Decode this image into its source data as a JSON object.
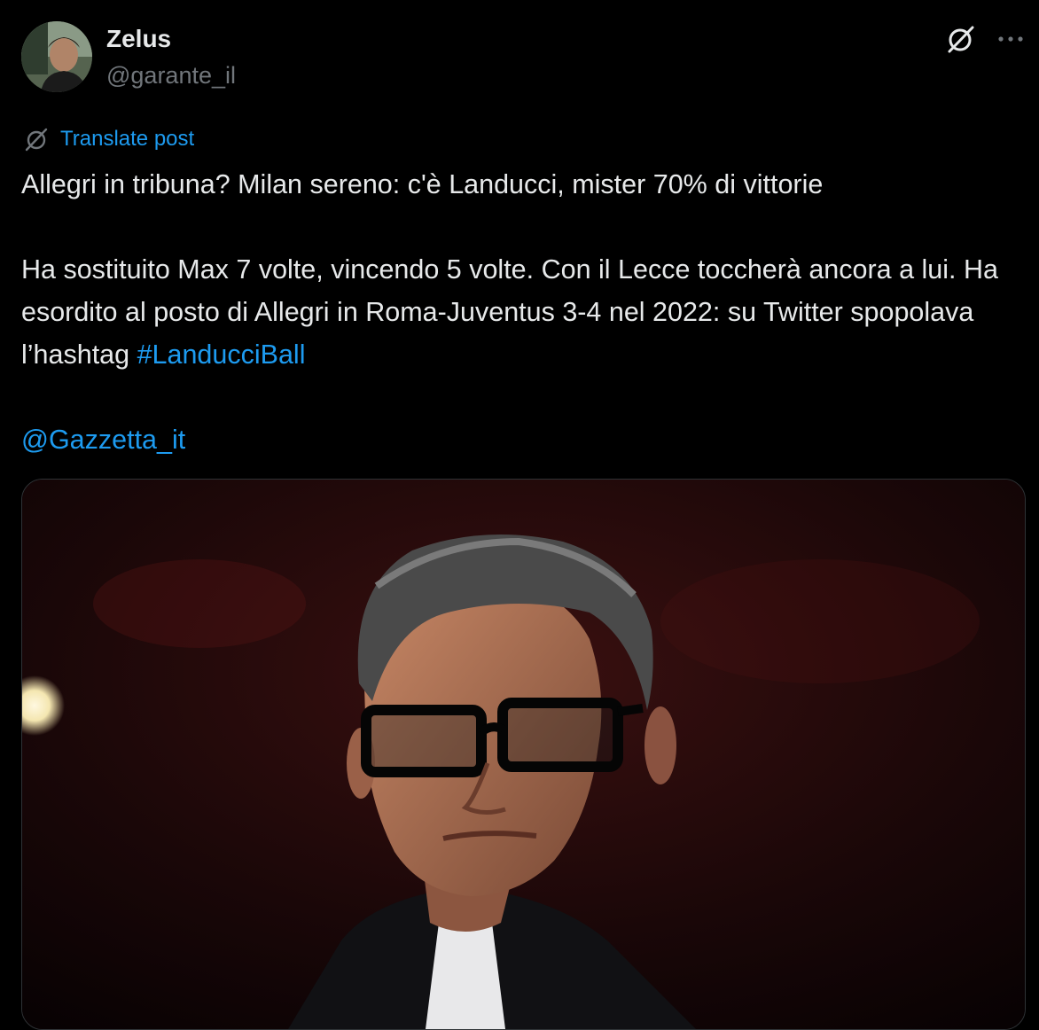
{
  "author": {
    "display_name": "Zelus",
    "handle": "@garante_il"
  },
  "header_icons": {
    "grok": "grok-icon",
    "more": "more-horizontal-icon"
  },
  "translate": {
    "icon": "translate-icon",
    "label": "Translate post"
  },
  "tweet": {
    "line1": "Allegri in tribuna? Milan sereno: c'è Landucci, mister 70% di vittorie",
    "para2_text": "Ha sostituito Max 7 volte, vincendo 5 volte. Con il Lecce toccherà ancora a lui. Ha esordito al posto di Allegri in Roma-Juventus 3-4 nel 2022: su Twitter spopolava l’hashtag ",
    "hashtag": "#LanducciBall",
    "mention": "@Gazzetta_it"
  },
  "media": {
    "description": "photo"
  },
  "colors": {
    "background": "#000000",
    "text": "#e7e9ea",
    "secondary": "#71767b",
    "accent": "#1d9bf0"
  }
}
